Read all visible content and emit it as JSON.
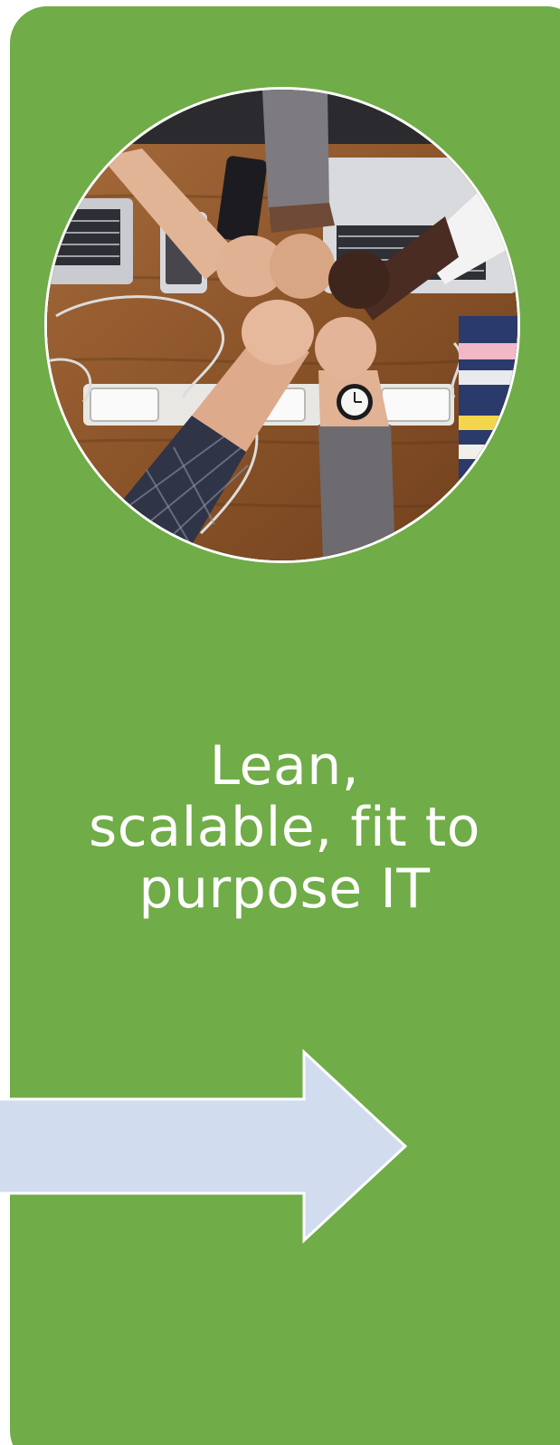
{
  "card": {
    "background_color": "#70ac47",
    "border_color": "#ffffff"
  },
  "headline": {
    "lines": [
      "Lean,",
      "scalable, fit to",
      "purpose IT"
    ],
    "color": "#ffffff"
  },
  "image": {
    "subject": "team-fist-bump-over-desk-photo"
  },
  "arrow": {
    "direction": "right",
    "fill_color": "#d1dcef",
    "stroke_color": "#ffffff"
  }
}
